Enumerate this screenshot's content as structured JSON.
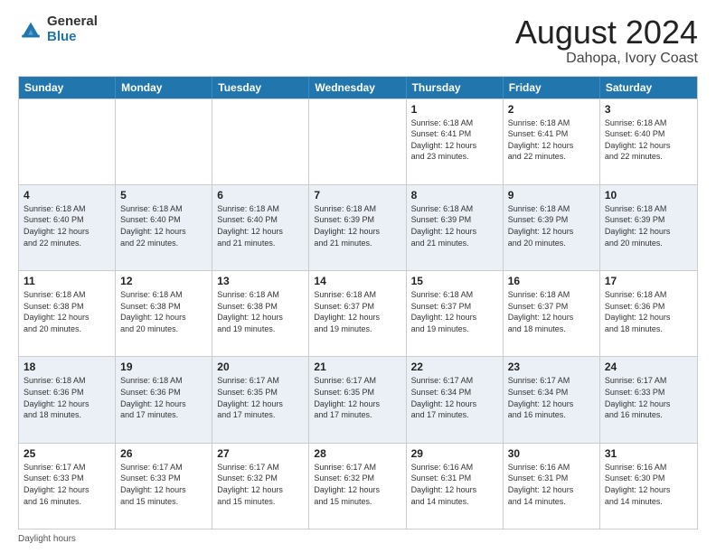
{
  "header": {
    "logo_general": "General",
    "logo_blue": "Blue",
    "month_title": "August 2024",
    "location": "Dahopa, Ivory Coast"
  },
  "calendar": {
    "days_of_week": [
      "Sunday",
      "Monday",
      "Tuesday",
      "Wednesday",
      "Thursday",
      "Friday",
      "Saturday"
    ],
    "rows": [
      [
        {
          "day": "",
          "info": ""
        },
        {
          "day": "",
          "info": ""
        },
        {
          "day": "",
          "info": ""
        },
        {
          "day": "",
          "info": ""
        },
        {
          "day": "1",
          "info": "Sunrise: 6:18 AM\nSunset: 6:41 PM\nDaylight: 12 hours\nand 23 minutes."
        },
        {
          "day": "2",
          "info": "Sunrise: 6:18 AM\nSunset: 6:41 PM\nDaylight: 12 hours\nand 22 minutes."
        },
        {
          "day": "3",
          "info": "Sunrise: 6:18 AM\nSunset: 6:40 PM\nDaylight: 12 hours\nand 22 minutes."
        }
      ],
      [
        {
          "day": "4",
          "info": "Sunrise: 6:18 AM\nSunset: 6:40 PM\nDaylight: 12 hours\nand 22 minutes."
        },
        {
          "day": "5",
          "info": "Sunrise: 6:18 AM\nSunset: 6:40 PM\nDaylight: 12 hours\nand 22 minutes."
        },
        {
          "day": "6",
          "info": "Sunrise: 6:18 AM\nSunset: 6:40 PM\nDaylight: 12 hours\nand 21 minutes."
        },
        {
          "day": "7",
          "info": "Sunrise: 6:18 AM\nSunset: 6:39 PM\nDaylight: 12 hours\nand 21 minutes."
        },
        {
          "day": "8",
          "info": "Sunrise: 6:18 AM\nSunset: 6:39 PM\nDaylight: 12 hours\nand 21 minutes."
        },
        {
          "day": "9",
          "info": "Sunrise: 6:18 AM\nSunset: 6:39 PM\nDaylight: 12 hours\nand 20 minutes."
        },
        {
          "day": "10",
          "info": "Sunrise: 6:18 AM\nSunset: 6:39 PM\nDaylight: 12 hours\nand 20 minutes."
        }
      ],
      [
        {
          "day": "11",
          "info": "Sunrise: 6:18 AM\nSunset: 6:38 PM\nDaylight: 12 hours\nand 20 minutes."
        },
        {
          "day": "12",
          "info": "Sunrise: 6:18 AM\nSunset: 6:38 PM\nDaylight: 12 hours\nand 20 minutes."
        },
        {
          "day": "13",
          "info": "Sunrise: 6:18 AM\nSunset: 6:38 PM\nDaylight: 12 hours\nand 19 minutes."
        },
        {
          "day": "14",
          "info": "Sunrise: 6:18 AM\nSunset: 6:37 PM\nDaylight: 12 hours\nand 19 minutes."
        },
        {
          "day": "15",
          "info": "Sunrise: 6:18 AM\nSunset: 6:37 PM\nDaylight: 12 hours\nand 19 minutes."
        },
        {
          "day": "16",
          "info": "Sunrise: 6:18 AM\nSunset: 6:37 PM\nDaylight: 12 hours\nand 18 minutes."
        },
        {
          "day": "17",
          "info": "Sunrise: 6:18 AM\nSunset: 6:36 PM\nDaylight: 12 hours\nand 18 minutes."
        }
      ],
      [
        {
          "day": "18",
          "info": "Sunrise: 6:18 AM\nSunset: 6:36 PM\nDaylight: 12 hours\nand 18 minutes."
        },
        {
          "day": "19",
          "info": "Sunrise: 6:18 AM\nSunset: 6:36 PM\nDaylight: 12 hours\nand 17 minutes."
        },
        {
          "day": "20",
          "info": "Sunrise: 6:17 AM\nSunset: 6:35 PM\nDaylight: 12 hours\nand 17 minutes."
        },
        {
          "day": "21",
          "info": "Sunrise: 6:17 AM\nSunset: 6:35 PM\nDaylight: 12 hours\nand 17 minutes."
        },
        {
          "day": "22",
          "info": "Sunrise: 6:17 AM\nSunset: 6:34 PM\nDaylight: 12 hours\nand 17 minutes."
        },
        {
          "day": "23",
          "info": "Sunrise: 6:17 AM\nSunset: 6:34 PM\nDaylight: 12 hours\nand 16 minutes."
        },
        {
          "day": "24",
          "info": "Sunrise: 6:17 AM\nSunset: 6:33 PM\nDaylight: 12 hours\nand 16 minutes."
        }
      ],
      [
        {
          "day": "25",
          "info": "Sunrise: 6:17 AM\nSunset: 6:33 PM\nDaylight: 12 hours\nand 16 minutes."
        },
        {
          "day": "26",
          "info": "Sunrise: 6:17 AM\nSunset: 6:33 PM\nDaylight: 12 hours\nand 15 minutes."
        },
        {
          "day": "27",
          "info": "Sunrise: 6:17 AM\nSunset: 6:32 PM\nDaylight: 12 hours\nand 15 minutes."
        },
        {
          "day": "28",
          "info": "Sunrise: 6:17 AM\nSunset: 6:32 PM\nDaylight: 12 hours\nand 15 minutes."
        },
        {
          "day": "29",
          "info": "Sunrise: 6:16 AM\nSunset: 6:31 PM\nDaylight: 12 hours\nand 14 minutes."
        },
        {
          "day": "30",
          "info": "Sunrise: 6:16 AM\nSunset: 6:31 PM\nDaylight: 12 hours\nand 14 minutes."
        },
        {
          "day": "31",
          "info": "Sunrise: 6:16 AM\nSunset: 6:30 PM\nDaylight: 12 hours\nand 14 minutes."
        }
      ]
    ]
  },
  "footer": {
    "note": "Daylight hours"
  }
}
